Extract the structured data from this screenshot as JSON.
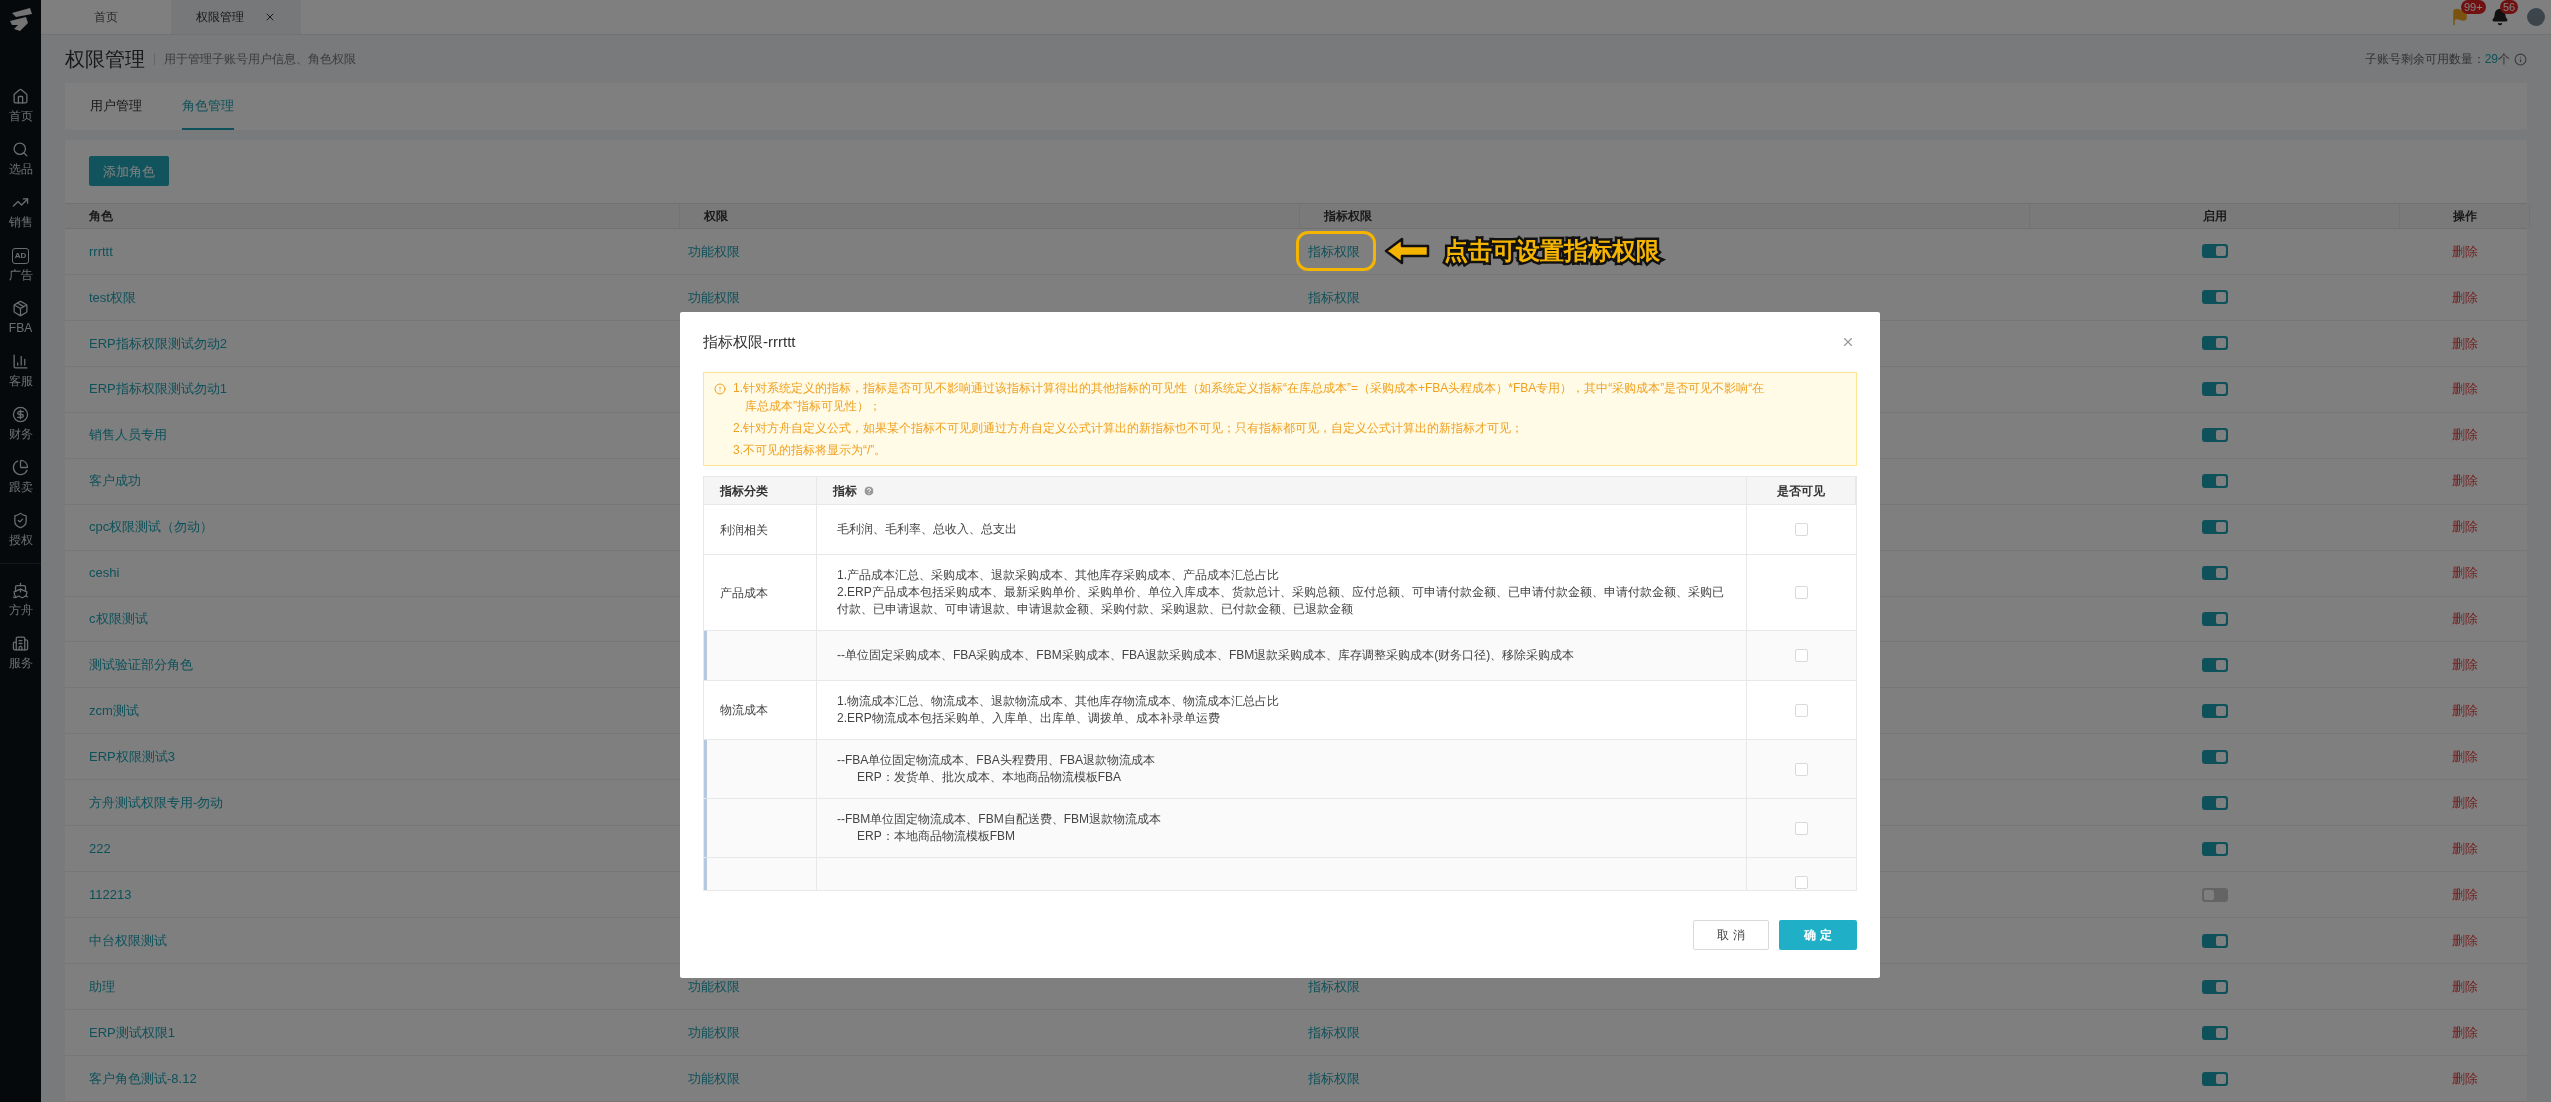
{
  "top_bar": {
    "tabs": [
      {
        "label": "首页",
        "selected": false,
        "closable": false
      },
      {
        "label": "权限管理",
        "selected": true,
        "closable": true
      }
    ],
    "flag_badge": "99+",
    "bell_badge": "56"
  },
  "sidebar": {
    "groups": [
      [
        {
          "label": "首页"
        },
        {
          "label": "选品"
        },
        {
          "label": "销售"
        },
        {
          "label": "广告",
          "icon_text": "AD"
        },
        {
          "label": "FBA"
        },
        {
          "label": "客服"
        },
        {
          "label": "财务"
        },
        {
          "label": "跟卖"
        },
        {
          "label": "授权"
        }
      ],
      [
        {
          "label": "方舟"
        },
        {
          "label": "服务"
        }
      ]
    ]
  },
  "page": {
    "title": "权限管理",
    "subtitle": "用于管理子账号用户信息、角色权限",
    "quota_label": "子账号剩余可用数量：",
    "quota_value": "29",
    "quota_unit": "个"
  },
  "tabs": [
    {
      "label": "用户管理",
      "selected": false
    },
    {
      "label": "角色管理",
      "selected": true
    }
  ],
  "add_button": "添加角色",
  "table": {
    "columns": [
      "角色",
      "权限",
      "指标权限",
      "启用",
      "操作"
    ],
    "rows": [
      {
        "name": "rrrttt",
        "permission": "功能权限",
        "metric_permission": "指标权限",
        "enabled": true,
        "action": "删除"
      },
      {
        "name": "test权限",
        "permission": "功能权限",
        "metric_permission": "指标权限",
        "enabled": true,
        "action": "删除"
      },
      {
        "name": "ERP指标权限测试勿动2",
        "enabled": true,
        "action": "删除"
      },
      {
        "name": "ERP指标权限测试勿动1",
        "enabled": true,
        "action": "删除"
      },
      {
        "name": "销售人员专用",
        "enabled": true,
        "action": "删除"
      },
      {
        "name": "客户成功",
        "enabled": true,
        "action": "删除"
      },
      {
        "name": "cpc权限测试（勿动）",
        "enabled": true,
        "action": "删除"
      },
      {
        "name": "ceshi",
        "enabled": true,
        "action": "删除"
      },
      {
        "name": "c权限测试",
        "enabled": true,
        "action": "删除"
      },
      {
        "name": "测试验证部分角色",
        "enabled": true,
        "action": "删除"
      },
      {
        "name": "zcm测试",
        "enabled": true,
        "action": "删除"
      },
      {
        "name": "ERP权限测试3",
        "enabled": true,
        "action": "删除"
      },
      {
        "name": "方舟测试权限专用-勿动",
        "enabled": true,
        "action": "删除"
      },
      {
        "name": "222",
        "enabled": true,
        "action": "删除"
      },
      {
        "name": "112213",
        "enabled": false,
        "action": "删除"
      },
      {
        "name": "中台权限测试",
        "enabled": true,
        "action": "删除"
      },
      {
        "name": "助理",
        "permission": "功能权限",
        "metric_permission": "指标权限",
        "enabled": true,
        "action": "删除"
      },
      {
        "name": "ERP测试权限1",
        "permission": "功能权限",
        "metric_permission": "指标权限",
        "enabled": true,
        "action": "删除"
      },
      {
        "name": "客户角色测试-8.12",
        "permission": "功能权限",
        "metric_permission": "指标权限",
        "enabled": true,
        "action": "删除"
      }
    ]
  },
  "annotation": {
    "text": "点击可设置指标权限"
  },
  "dialog": {
    "title": "指标权限-rrrttt",
    "notices": [
      "1.针对系统定义的指标，指标是否可见不影响通过该指标计算得出的其他指标的可见性（如系统定义指标“在库总成本”=（采购成本+FBA头程成本）*FBA专用），其中“采购成本”是否可见不影响“在库总成本”指标可见性）；",
      "2.针对方舟自定义公式，如果某个指标不可见则通过方舟自定义公式计算出的新指标也不可见；只有指标都可见，自定义公式计算出的新指标才可见；",
      "3.不可见的指标将显示为“/”。"
    ],
    "columns": [
      "指标分类",
      "指标",
      "是否可见"
    ],
    "rows": [
      {
        "kind": "main",
        "category": "利润相关",
        "lines": [
          "毛利润、毛利率、总收入、总支出"
        ],
        "visible": false
      },
      {
        "kind": "main",
        "category": "产品成本",
        "lines": [
          "1.产品成本汇总、采购成本、退款采购成本、其他库存采购成本、产品成本汇总占比",
          "2.ERP产品成本包括采购成本、最新采购单价、采购单价、单位入库成本、货款总计、采购总额、应付总额、可申请付款金额、已申请付款金额、申请付款金额、采购已付款、已申请退款、可申请退款、申请退款金额、采购付款、采购退款、已付款金额、已退款金额"
        ],
        "visible": false
      },
      {
        "kind": "sub",
        "lines": [
          "--单位固定采购成本、FBA采购成本、FBM采购成本、FBA退款采购成本、FBM退款采购成本、库存调整采购成本(财务口径)、移除采购成本"
        ],
        "visible": false
      },
      {
        "kind": "main",
        "category": "物流成本",
        "lines": [
          "1.物流成本汇总、物流成本、退款物流成本、其他库存物流成本、物流成本汇总占比",
          "2.ERP物流成本包括采购单、入库单、出库单、调拨单、成本补录单运费"
        ],
        "visible": false
      },
      {
        "kind": "sub",
        "lines": [
          "--FBA单位固定物流成本、FBA头程费用、FBA退款物流成本",
          "ERP：发货单、批次成本、本地商品物流模板FBA"
        ],
        "visible": false
      },
      {
        "kind": "sub",
        "lines": [
          "--FBM单位固定物流成本、FBM自配送费、FBM退款物流成本",
          "ERP：本地商品物流模板FBM"
        ],
        "visible": false
      },
      {
        "kind": "sub",
        "visible": false
      }
    ],
    "cancel_button": "取 消",
    "ok_button": "确 定"
  }
}
